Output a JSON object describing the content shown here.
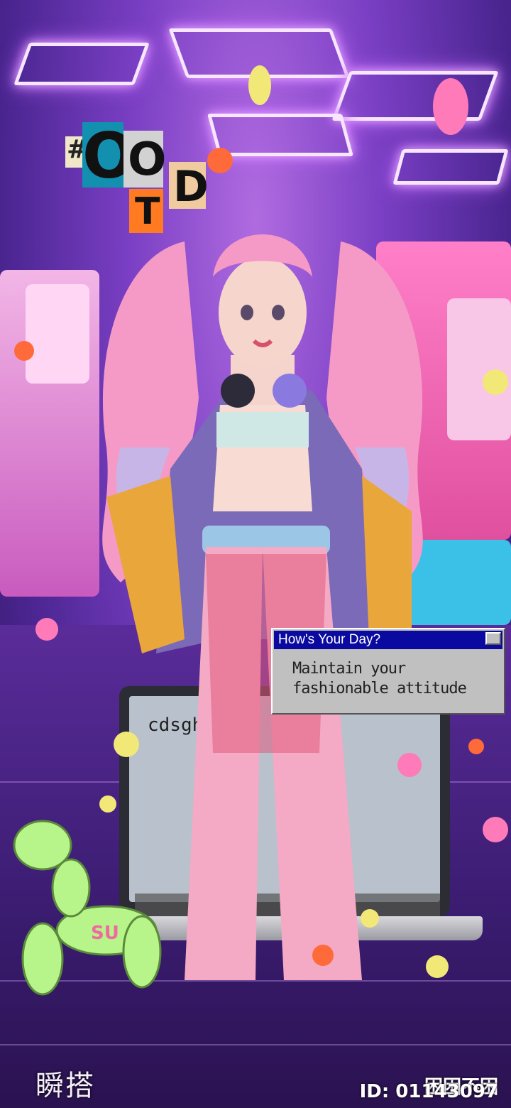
{
  "hashtag": {
    "symbol": "#",
    "letters": [
      "O",
      "O",
      "T",
      "D"
    ]
  },
  "dialog": {
    "title": "How's Your Day?",
    "line1": "Maintain your",
    "line2": "fashionable attitude"
  },
  "laptop": {
    "text": "cdsgh      09"
  },
  "balloon": {
    "text": "SU"
  },
  "footer": {
    "brand": "瞬搭",
    "user_name": "困困不困",
    "user_id": "ID:  01143097"
  },
  "colors": {
    "background": "#7a3fc4",
    "dialog_title_bar": "#0a0aa0",
    "hair": "#f59ac6"
  }
}
